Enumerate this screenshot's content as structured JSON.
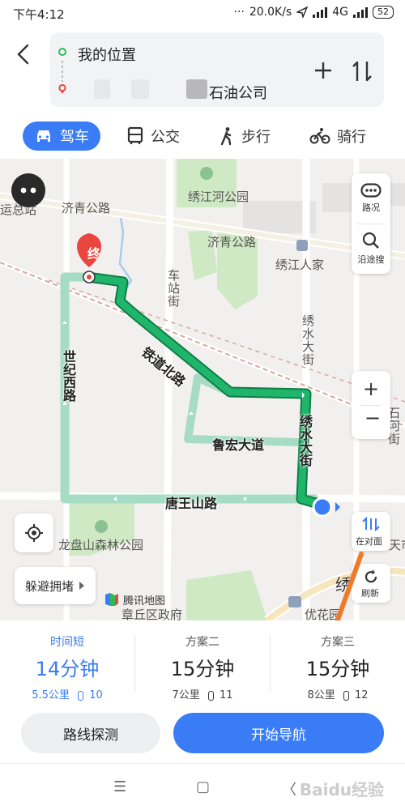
{
  "status_bar": {
    "time": "下午4:12",
    "speed": "20.0K/s",
    "network": "4G",
    "battery": "52"
  },
  "route": {
    "start": "我的位置",
    "end": "石油公司"
  },
  "tabs": [
    {
      "label": "驾车",
      "icon": "car-icon",
      "active": true
    },
    {
      "label": "公交",
      "icon": "bus-icon",
      "active": false
    },
    {
      "label": "步行",
      "icon": "walk-icon",
      "active": false
    },
    {
      "label": "骑行",
      "icon": "bike-icon",
      "active": false
    }
  ],
  "map": {
    "end_marker": "终",
    "labels": {
      "jiqing1": "济青公路",
      "jiqing2": "济青公路",
      "yunzong": "运总站",
      "xiujianghe": "绣江河公园",
      "xiujiangrenjia": "绣江人家",
      "chezhanjie": "车站街",
      "tiedaobei": "铁道北路",
      "xiushuidajie_top": "绣水大街",
      "xiushuidajie_route": "绣水大街",
      "luhong": "鲁宏大道",
      "shiji": "世纪西路",
      "tangwang": "唐王山路",
      "longpan": "龙盘山森林公园",
      "zhangqiu": "章丘区政府",
      "shihe": "石河街",
      "youhua": "优花园",
      "xiu_bottom": "绣",
      "tianshi": "天市"
    },
    "controls": {
      "traffic": "路况",
      "search_along": "沿途搜",
      "zoom_in": "+",
      "zoom_out": "−",
      "opposite": "在对面",
      "refresh": "刷新",
      "avoid": "躲避拥堵"
    },
    "logo": "腾讯地图"
  },
  "plans": [
    {
      "label": "时间短",
      "duration": "14分钟",
      "distance": "5.5公里",
      "lights": "10",
      "selected": true
    },
    {
      "label": "方案二",
      "duration": "15分钟",
      "distance": "7公里",
      "lights": "11",
      "selected": false
    },
    {
      "label": "方案三",
      "duration": "15分钟",
      "distance": "8公里",
      "lights": "12",
      "selected": false
    }
  ],
  "actions": {
    "probe": "路线探测",
    "navigate": "开始导航"
  },
  "watermark": "Baidu经验",
  "colors": {
    "accent": "#3a7cf5",
    "route": "#1aa862",
    "alt_route": "#a6dcc4",
    "end_marker": "#e8463f",
    "arrow": "#f07a2a"
  }
}
